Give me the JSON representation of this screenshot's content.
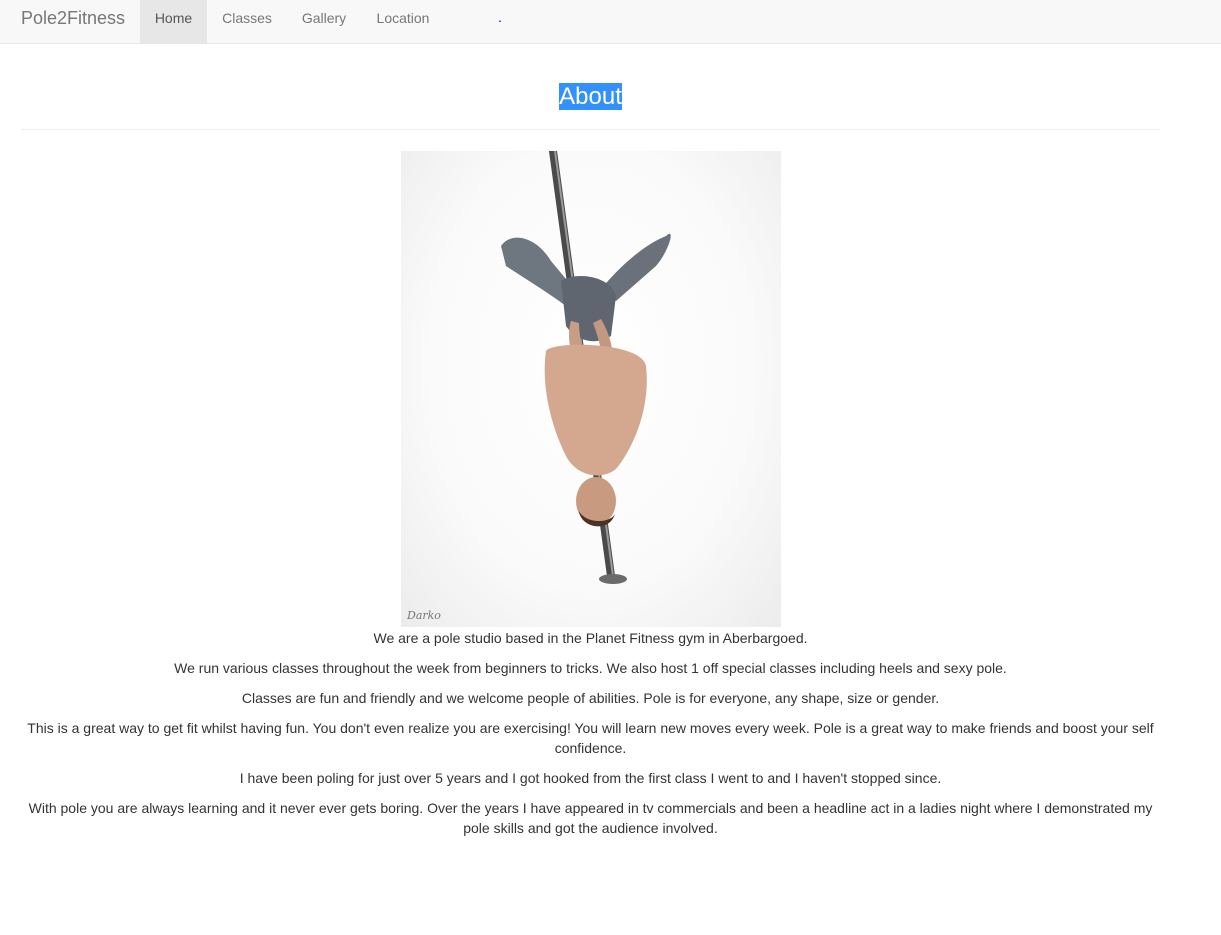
{
  "nav": {
    "brand": "Pole2Fitness",
    "items": [
      {
        "label": "Home",
        "active": true
      },
      {
        "label": "Classes",
        "active": false
      },
      {
        "label": "Gallery",
        "active": false
      },
      {
        "label": "Location",
        "active": false
      }
    ],
    "stray": "."
  },
  "main": {
    "title": "About",
    "photo_signature": "Darko",
    "paragraphs": [
      "We are a pole studio based in the Planet Fitness gym in Aberbargoed.",
      "We run various classes throughout the week from beginners to tricks. We also host 1 off special classes including heels and sexy pole.",
      "Classes are fun and friendly and we welcome people of abilities. Pole is for everyone, any shape, size or gender.",
      "This is a great way to get fit whilst having fun. You don't even realize you are exercising! You will learn new moves every week. Pole is a great way to make friends and boost your self confidence.",
      "I have been poling for just over 5 years and I got hooked from the first class I went to and I haven't stopped since.",
      "With pole you are always learning and it never ever gets boring. Over the years I have appeared in tv commercials and been a headline act in a ladies night where I demonstrated my pole skills and got the audience involved."
    ]
  },
  "colors": {
    "navbar_bg": "#f8f8f8",
    "active_tab_bg": "#e7e7e7",
    "selection_highlight": "#3390ff",
    "link_dot": "#0000ee"
  }
}
